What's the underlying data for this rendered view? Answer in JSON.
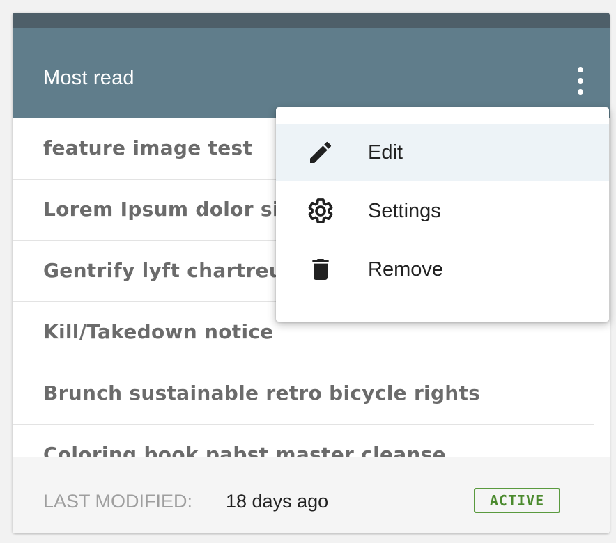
{
  "widget": {
    "title": "Most read",
    "header_color": "#607d8b",
    "topbar_color": "#4e5f69"
  },
  "list": {
    "items": [
      {
        "label": "feature image test"
      },
      {
        "label": "Lorem Ipsum dolor sit amet"
      },
      {
        "label": "Gentrify lyft chartreuse"
      },
      {
        "label": "Kill/Takedown notice"
      },
      {
        "label": "Brunch sustainable retro bicycle rights"
      },
      {
        "label": "Coloring book pabst master cleanse"
      }
    ]
  },
  "footer": {
    "last_modified_label": "LAST MODIFIED:",
    "last_modified_value": "18 days ago",
    "status_badge": "ACTIVE",
    "status_color": "#5a9a3e"
  },
  "menu": {
    "items": [
      {
        "label": "Edit",
        "icon": "pencil-icon"
      },
      {
        "label": "Settings",
        "icon": "gear-icon"
      },
      {
        "label": "Remove",
        "icon": "trash-icon"
      }
    ],
    "highlight_color": "#edf3f7"
  }
}
